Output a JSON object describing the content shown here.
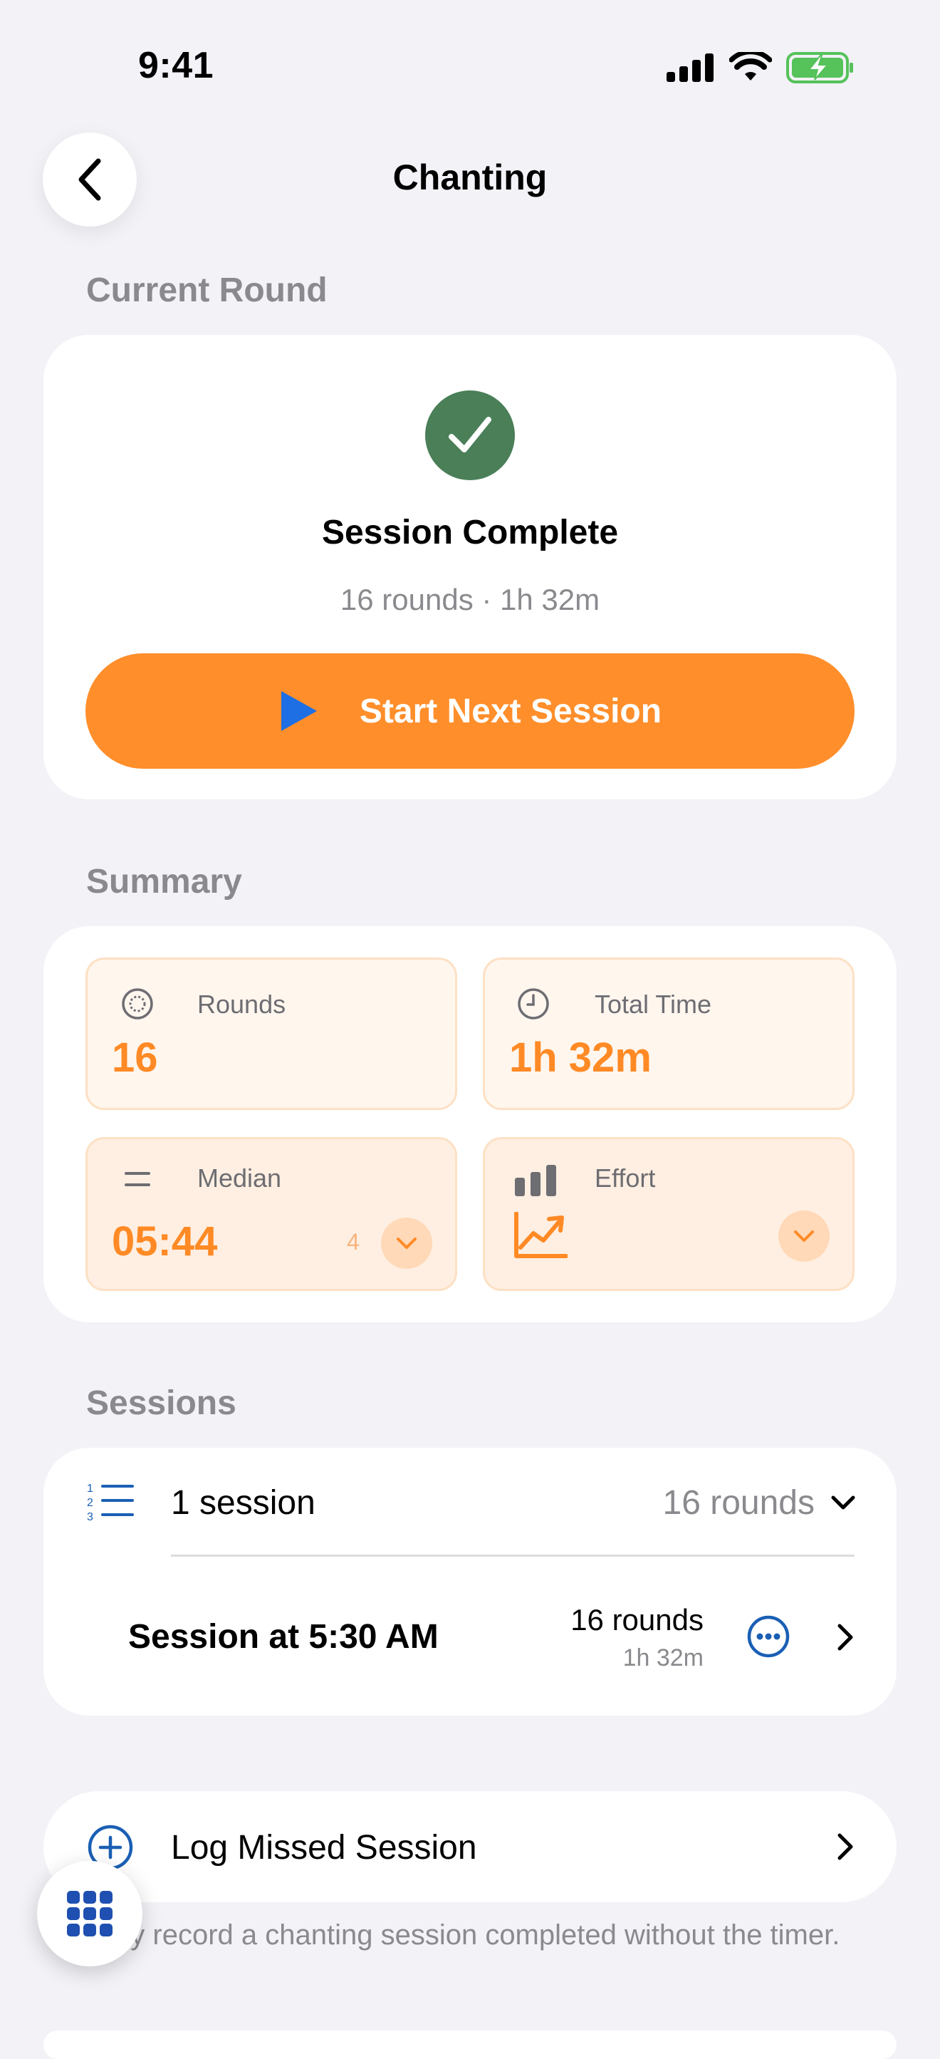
{
  "status_bar": {
    "time": "9:41"
  },
  "nav": {
    "title": "Chanting"
  },
  "current_round": {
    "header": "Current Round",
    "title": "Session Complete",
    "subtitle": "16 rounds · 1h 32m",
    "start_button": "Start Next Session"
  },
  "summary": {
    "header": "Summary",
    "rounds": {
      "label": "Rounds",
      "value": "16"
    },
    "total_time": {
      "label": "Total Time",
      "value": "1h 32m"
    },
    "median": {
      "label": "Median",
      "value": "05:44",
      "badge": "4"
    },
    "effort": {
      "label": "Effort"
    }
  },
  "sessions": {
    "header": "Sessions",
    "group_label": "1 session",
    "group_rounds": "16 rounds",
    "items": [
      {
        "title": "Session at 5:30 AM",
        "rounds": "16 rounds",
        "duration": "1h 32m"
      }
    ]
  },
  "log_missed": {
    "label": "Log Missed Session",
    "note": "ually record a chanting session completed without the timer."
  },
  "colors": {
    "accent": "#ff8e2b",
    "success": "#4a7f58",
    "link_blue": "#1a5fb4",
    "play_blue": "#1d6fe3"
  }
}
